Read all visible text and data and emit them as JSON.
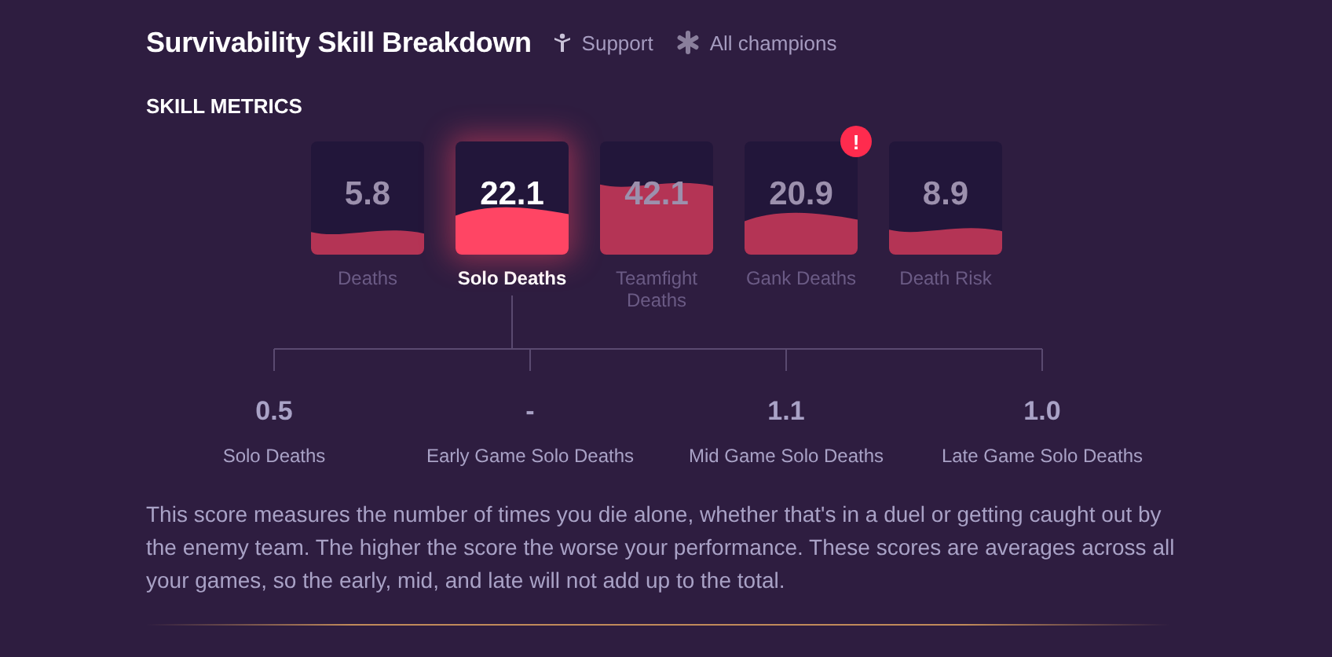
{
  "header": {
    "title": "Survivability Skill Breakdown",
    "filters": [
      {
        "kind": "role",
        "label": "Support"
      },
      {
        "kind": "champion",
        "label": "All champions"
      }
    ]
  },
  "section_title": "SKILL METRICS",
  "metrics": [
    {
      "value": "5.8",
      "label": "Deaths",
      "selected": false,
      "alert": false
    },
    {
      "value": "22.1",
      "label": "Solo Deaths",
      "selected": true,
      "alert": false
    },
    {
      "value": "42.1",
      "label": "Teamfight Deaths",
      "selected": false,
      "alert": false
    },
    {
      "value": "20.9",
      "label": "Gank Deaths",
      "selected": false,
      "alert": true,
      "alert_text": "!"
    },
    {
      "value": "8.9",
      "label": "Death Risk",
      "selected": false,
      "alert": false
    }
  ],
  "breakdown": [
    {
      "value": "0.5",
      "label": "Solo Deaths"
    },
    {
      "value": "-",
      "label": "Early Game Solo Deaths"
    },
    {
      "value": "1.1",
      "label": "Mid Game Solo Deaths"
    },
    {
      "value": "1.0",
      "label": "Late Game Solo Deaths"
    }
  ],
  "description": "This score measures the number of times you die alone, whether that's in a duel or getting caught out by the enemy team. The higher the score the worse your performance. These scores are averages across all your games, so the early, mid, and late will not add up to the total."
}
